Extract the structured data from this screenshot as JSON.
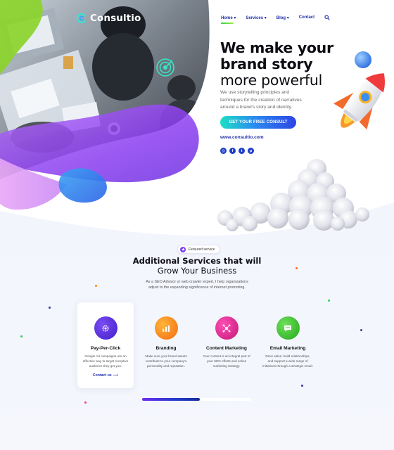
{
  "brand": {
    "name": "Consultio",
    "accent": "#2cd34a",
    "primary": "#1f2fa8"
  },
  "nav": {
    "items": [
      {
        "label": "Home",
        "active": true
      },
      {
        "label": "Services",
        "active": false
      },
      {
        "label": "Blog",
        "active": false
      },
      {
        "label": "Contact",
        "active": false
      }
    ],
    "search_icon": "search-icon"
  },
  "hero": {
    "title_line1": "We make your",
    "title_line2": "brand story",
    "title_line3": "more powerful",
    "description": "We use storytelling principles and techniques for the creation of narratives around a brand's story and identity.",
    "cta_label": "GET YOUR FREE CONSULT",
    "website": "www.consultio.com",
    "socials": [
      "instagram-icon",
      "facebook-icon",
      "twitter-icon",
      "pinterest-icon"
    ]
  },
  "services": {
    "badge": "Fetaured service",
    "title": "Additional Services that will",
    "subtitle": "Grow Your Business",
    "description": "As a SEO Advisor or web crawler expert, I help organizations adjust to the expanding significance of internet promoting.",
    "cards": [
      {
        "title": "Pay-Per-Click",
        "text": "Google Ad campaigns are an effective way to target receptive audience they get you.",
        "link": "Contact us",
        "icon": "gear-icon",
        "color": "#5b2de3"
      },
      {
        "title": "Branding",
        "text": "Make sure your brand assets contribute to your company's personality and reputation.",
        "icon": "chart-icon",
        "color": "#ff8a15"
      },
      {
        "title": "Content Marketing",
        "text": "Your content is an integral part of your SEO efforts and online marketing strategy.",
        "icon": "network-icon",
        "color": "#e0208c"
      },
      {
        "title": "Email Marketing",
        "text": "Drive sales, build relationships, and support a wide range of initiatives through a strategic email.",
        "icon": "chat-icon",
        "color": "#3cc72c"
      }
    ],
    "slider_progress": 0.53
  }
}
